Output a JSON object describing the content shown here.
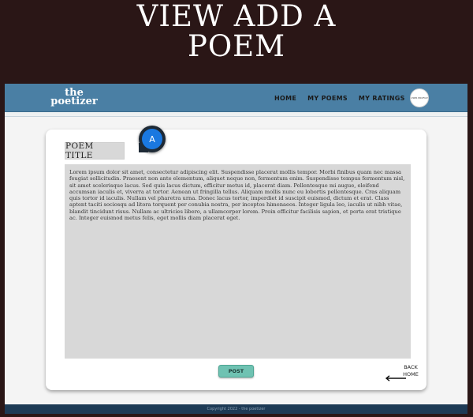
{
  "hero": {
    "line1": "VIEW ADD A",
    "line2": "POEM"
  },
  "navbar": {
    "logo_line1": "the",
    "logo_line2": "poetizer",
    "links": [
      "HOME",
      "MY POEMS",
      "MY RATINGS"
    ],
    "avatar_text": "USER PROFILE",
    "background_color": "#4a7fa4"
  },
  "editor": {
    "title_placeholder": "POEM TITLE",
    "cursor_label": "A",
    "body_text": "Lorem ipsum dolor sit amet, consectetur adipiscing elit. Suspendisse placerat mollis tempor. Morbi finibus quam nec massa feugiat sollicitudin. Praesent non ante elementum, aliquet neque non, fermentum enim. Suspendisse tempus fermentum nisl, sit amet scelerisque lacus. Sed quis lacus dictum, efficitur metus id, placerat diam. Pellentesque mi augue, eleifend accumsan iaculis et, viverra at tortor. Aenean ut fringilla tellus. Aliquam mollis nunc eu lobortis pellentesque. Cras aliquam quis tortor id iaculis. Nullam vel pharetra urna. Donec lacus tortor, imperdiet id suscipit euismod, dictum et erat. Class aptent taciti sociosqu ad litora torquent per conubia nostra, per inceptos himenaeos. Integer ligula leo, iaculis ut nibh vitae, blandit tincidunt risus. Nullam ac ultricies libero, a ullamcorper lorem. Proin efficitur facilisis sapien, et porta erat tristique ac. Integer euismod metus felis, eget mollis diam placerat eget.",
    "post_label": "POST",
    "back_line1": "BACK",
    "back_line2": "HOME",
    "accent_color": "#6fc2b2"
  },
  "footer": {
    "text": "Copyright 2022 - the poetizer"
  }
}
